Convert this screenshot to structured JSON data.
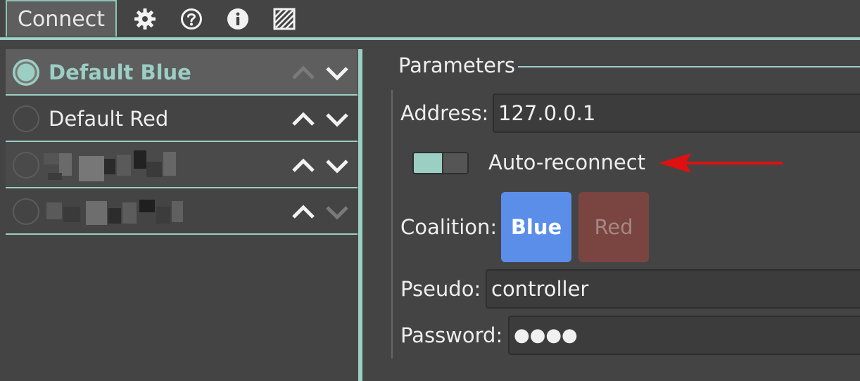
{
  "toolbar": {
    "connect_label": "Connect",
    "icons": [
      "gear-icon",
      "help-icon",
      "info-icon",
      "stripes-icon"
    ]
  },
  "profiles": [
    {
      "label": "Default Blue",
      "selected": true
    },
    {
      "label": "Default Red",
      "selected": false
    },
    {
      "label": "",
      "selected": false,
      "obscured": true
    },
    {
      "label": "",
      "selected": false,
      "obscured": true
    }
  ],
  "parameters": {
    "title": "Parameters",
    "address_label": "Address:",
    "address_value": "127.0.0.1",
    "auto_reconnect_label": "Auto-reconnect",
    "auto_reconnect_on": true,
    "coalition_label": "Coalition:",
    "coalition_blue": "Blue",
    "coalition_red": "Red",
    "pseudo_label": "Pseudo:",
    "pseudo_value": "controller",
    "password_label": "Password:",
    "password_value": "●●●●"
  },
  "colors": {
    "accent": "#9ccfc4",
    "background": "#444444",
    "blue": "#5b8ee8",
    "red": "#7a4540",
    "arrow": "#e01010"
  }
}
